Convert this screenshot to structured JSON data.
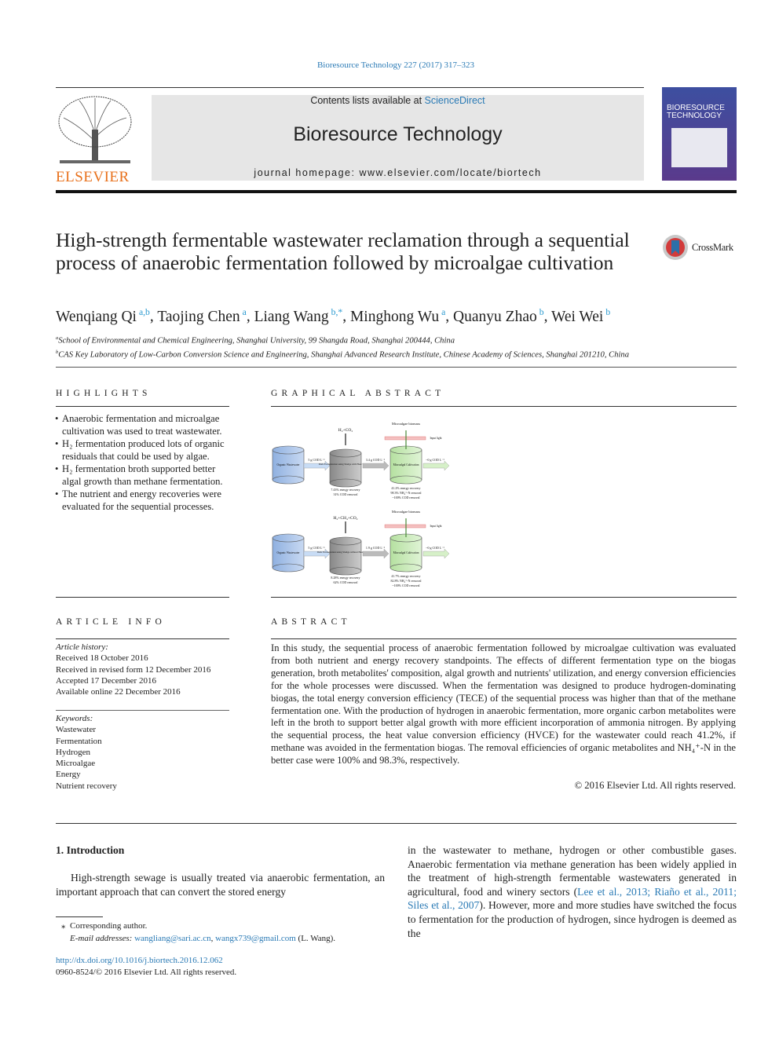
{
  "header": {
    "citation": "Bioresource Technology 227 (2017) 317–323",
    "contents_prefix": "Contents lists available at ",
    "contents_link": "ScienceDirect",
    "journal_title": "Bioresource Technology",
    "homepage": "journal homepage: www.elsevier.com/locate/biortech",
    "publisher_logo": "ELSEVIER",
    "cover_title": "BIORESOURCE TECHNOLOGY",
    "crossmark": "CrossMark"
  },
  "article": {
    "title": "High-strength fermentable wastewater reclamation through a sequential process of anaerobic fermentation followed by microalgae cultivation",
    "authors": [
      {
        "name": "Wenqiang Qi",
        "aff": "a,b"
      },
      {
        "name": "Taojing Chen",
        "aff": "a"
      },
      {
        "name": "Liang Wang",
        "aff": "b,*"
      },
      {
        "name": "Minghong Wu",
        "aff": "a"
      },
      {
        "name": "Quanyu Zhao",
        "aff": "b"
      },
      {
        "name": "Wei Wei",
        "aff": "b"
      }
    ],
    "affiliations": [
      {
        "mark": "a",
        "text": "School of Environmental and Chemical Engineering, Shanghai University, 99 Shangda Road, Shanghai 200444, China"
      },
      {
        "mark": "b",
        "text": "CAS Key Laboratory of Low-Carbon Conversion Science and Engineering, Shanghai Advanced Research Institute, Chinese Academy of Sciences, Shanghai 201210, China"
      }
    ]
  },
  "highlights": {
    "heading": "HIGHLIGHTS",
    "items": [
      "Anaerobic fermentation and microalgae cultivation was used to treat wastewater.",
      "H₂ fermentation produced lots of organic residuals that could be used by algae.",
      "H₂ fermentation broth supported better algal growth than methane fermentation.",
      "The nutrient and energy recoveries were evaluated for the sequential processes."
    ]
  },
  "graphical_abstract": {
    "heading": "GRAPHICAL ABSTRACT",
    "top": {
      "gas": "H₂+CO₂",
      "biomass": "Microalgae biomass",
      "light": "Input light",
      "tank1": "Organic Wastewater",
      "feed": "5 g COD L⁻¹",
      "tank2": "Dark Fermentation using Sludge with Heat Treatment",
      "mid": "3.4 g COD L⁻¹",
      "tank3": "Microalgal Cultivation",
      "out": "~0 g COD L⁻¹",
      "stats2": [
        "7.43% energy recovery",
        "31% COD removal"
      ],
      "stats3": [
        "41.2% energy recovery",
        "98.3% NH₄⁺-N removal",
        "~100% COD removal"
      ]
    },
    "bottom": {
      "gas": "H₂+CH₄+CO₂",
      "biomass": "Microalgae biomass",
      "light": "Input light",
      "tank1": "Organic Wastewater",
      "feed": "5 g COD L⁻¹",
      "tank2": "Dark Fermentation using Sludge without Heat Treatment",
      "mid": "1.9 g COD L⁻¹",
      "tank3": "Microalgal Cultivation",
      "out": "~0 g COD L⁻¹",
      "stats2": [
        "8.28% energy recovery",
        "62% COD removal"
      ],
      "stats3": [
        "41.7% energy recovery",
        "82.8% NH₄⁺-N removal",
        "~100% COD removal"
      ]
    }
  },
  "article_info": {
    "heading": "ARTICLE INFO",
    "history_label": "Article history:",
    "history": [
      "Received 18 October 2016",
      "Received in revised form 12 December 2016",
      "Accepted 17 December 2016",
      "Available online 22 December 2016"
    ],
    "keywords_label": "Keywords:",
    "keywords": [
      "Wastewater",
      "Fermentation",
      "Hydrogen",
      "Microalgae",
      "Energy",
      "Nutrient recovery"
    ]
  },
  "abstract": {
    "heading": "ABSTRACT",
    "text": "In this study, the sequential process of anaerobic fermentation followed by microalgae cultivation was evaluated from both nutrient and energy recovery standpoints. The effects of different fermentation type on the biogas generation, broth metabolites' composition, algal growth and nutrients' utilization, and energy conversion efficiencies for the whole processes were discussed. When the fermentation was designed to produce hydrogen-dominating biogas, the total energy conversion efficiency (TECE) of the sequential process was higher than that of the methane fermentation one. With the production of hydrogen in anaerobic fermentation, more organic carbon metabolites were left in the broth to support better algal growth with more efficient incorporation of ammonia nitrogen. By applying the sequential process, the heat value conversion efficiency (HVCE) for the wastewater could reach 41.2%, if methane was avoided in the fermentation biogas. The removal efficiencies of organic metabolites and NH₄⁺-N in the better case were 100% and 98.3%, respectively.",
    "copyright": "© 2016 Elsevier Ltd. All rights reserved."
  },
  "introduction": {
    "heading": "1. Introduction",
    "left": "High-strength sewage is usually treated via anaerobic fermentation, an important approach that can convert the stored energy",
    "right_pre": "in the wastewater to methane, hydrogen or other combustible gases. Anaerobic fermentation via methane generation has been widely applied in the treatment of high-strength fermentable wastewaters generated in agricultural, food and winery sectors (",
    "refs": [
      "Lee et al., 2013;",
      "Riaño et al., 2011;",
      "Siles et al., 2007"
    ],
    "right_post": "). However, more and more studies have switched the focus to fermentation for the production of hydrogen, since hydrogen is deemed as the"
  },
  "footnote": {
    "corresponding": "Corresponding author.",
    "email_label": "E-mail addresses:",
    "emails": [
      "wangliang@sari.ac.cn",
      "wangx739@gmail.com"
    ],
    "email_suffix": "(L. Wang)."
  },
  "doi": {
    "link": "http://dx.doi.org/10.1016/j.biortech.2016.12.062",
    "issn": "0960-8524/© 2016 Elsevier Ltd. All rights reserved."
  }
}
